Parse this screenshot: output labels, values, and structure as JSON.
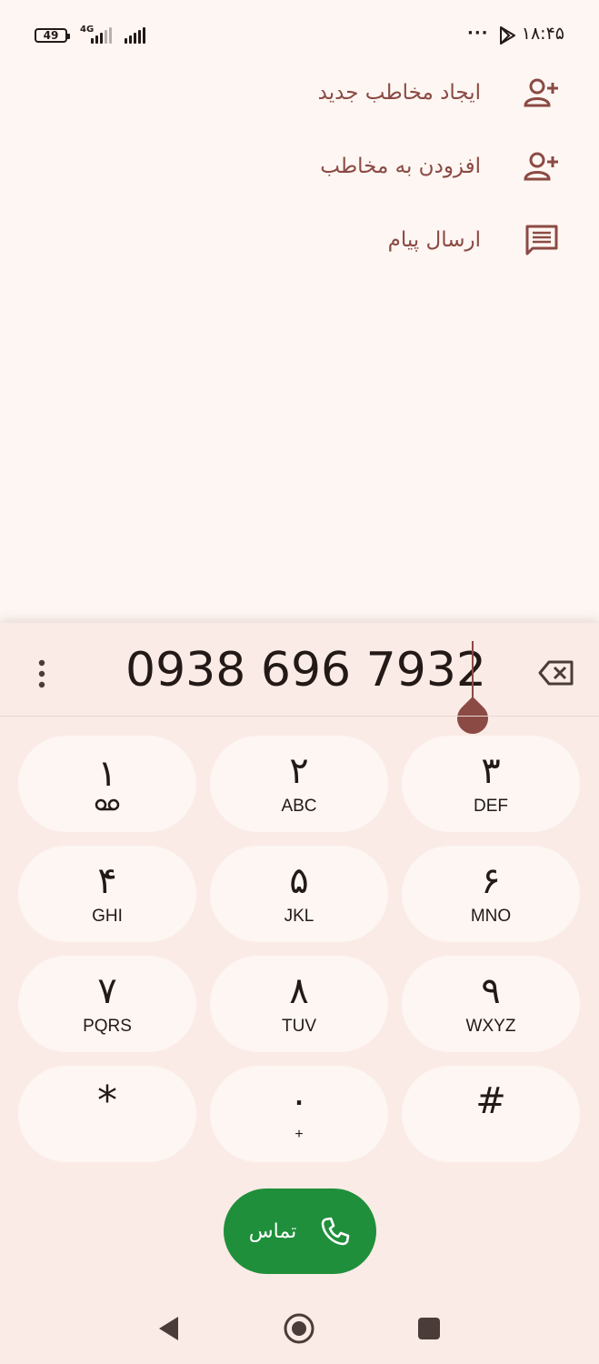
{
  "status_bar": {
    "time": "۱۸:۴۵",
    "battery": "49",
    "network": "4G",
    "overflow": "···",
    "icons": [
      "battery-icon",
      "signal-icon",
      "play-store-icon"
    ]
  },
  "actions": [
    {
      "label": "ایجاد مخاطب جدید",
      "icon": "add-person-icon"
    },
    {
      "label": "افزودن به مخاطب",
      "icon": "add-person-icon"
    },
    {
      "label": "ارسال پیام",
      "icon": "message-icon"
    }
  ],
  "dialer": {
    "number": "0938 696 7932",
    "keys": [
      {
        "digit": "۱",
        "letters": ""
      },
      {
        "digit": "۲",
        "letters": "ABC"
      },
      {
        "digit": "۳",
        "letters": "DEF"
      },
      {
        "digit": "۴",
        "letters": "GHI"
      },
      {
        "digit": "۵",
        "letters": "JKL"
      },
      {
        "digit": "۶",
        "letters": "MNO"
      },
      {
        "digit": "۷",
        "letters": "PQRS"
      },
      {
        "digit": "۸",
        "letters": "TUV"
      },
      {
        "digit": "۹",
        "letters": "WXYZ"
      },
      {
        "digit": "*",
        "letters": ""
      },
      {
        "digit": "۰",
        "letters": "+"
      },
      {
        "digit": "#",
        "letters": ""
      }
    ],
    "call_label": "تماس"
  },
  "colors": {
    "accent": "#8b4a43",
    "call_green": "#1f8f3b",
    "background": "#fdf6f3",
    "keypad_bg": "#fbebe6"
  }
}
